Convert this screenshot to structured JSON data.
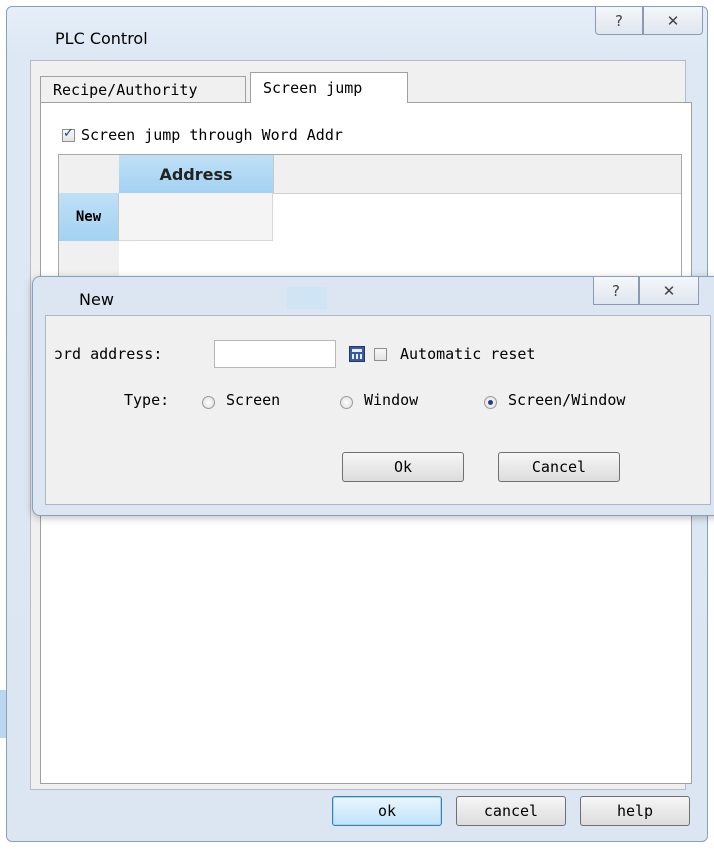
{
  "window": {
    "title": "PLC Control",
    "help_glyph": "?",
    "close_glyph": "✕"
  },
  "tabs": [
    {
      "label": "Recipe/Authority",
      "active": false
    },
    {
      "label": "Screen jump",
      "active": true
    }
  ],
  "screen_jump": {
    "checkbox_label": "Screen jump through Word Addr",
    "checked": true
  },
  "grid": {
    "columns": [
      "Address"
    ],
    "rows": [
      {
        "header": "New",
        "address": ""
      }
    ]
  },
  "new_dialog": {
    "title": "New",
    "help_glyph": "?",
    "close_glyph": "✕",
    "word_address_label": "ɔrd address:",
    "word_address_value": "",
    "auto_reset_label": "Automatic reset",
    "auto_reset_checked": false,
    "type_label": "Type:",
    "type_options": [
      {
        "label": "Screen",
        "selected": false
      },
      {
        "label": "Window",
        "selected": false
      },
      {
        "label": "Screen/Window",
        "selected": true
      }
    ],
    "ok_label": "Ok",
    "cancel_label": "Cancel"
  },
  "footer": {
    "ok_label": "ok",
    "cancel_label": "cancel",
    "help_label": "help"
  },
  "icons": {
    "calculator": "calculator-icon"
  },
  "colors": {
    "selection_blue": "#a3d2f2",
    "window_frame": "#dce6f2"
  }
}
